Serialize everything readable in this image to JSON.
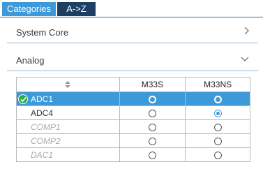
{
  "tabs": [
    {
      "label": "Categories"
    },
    {
      "label": "A->Z"
    }
  ],
  "sections": {
    "system_core": {
      "label": "System Core"
    },
    "analog": {
      "label": "Analog"
    }
  },
  "table": {
    "headers": [
      "M33S",
      "M33NS"
    ],
    "rows": [
      {
        "name": "ADC1",
        "state": "selected",
        "m33s": false,
        "m33ns": false
      },
      {
        "name": "ADC4",
        "state": "normal",
        "m33s": false,
        "m33ns": true
      },
      {
        "name": "COMP1",
        "state": "disabled",
        "m33s": false,
        "m33ns": false
      },
      {
        "name": "COMP2",
        "state": "disabled",
        "m33s": false,
        "m33ns": false
      },
      {
        "name": "DAC1",
        "state": "disabled",
        "m33s": false,
        "m33ns": false
      }
    ]
  },
  "colors": {
    "accent": "#3c9ad8",
    "tab_dark": "#1d3f63",
    "check": "#2faa4a"
  }
}
